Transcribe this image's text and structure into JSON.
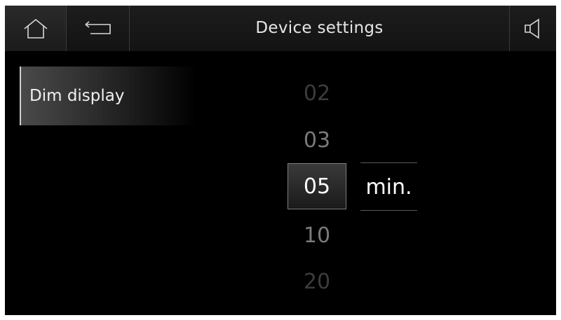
{
  "header": {
    "title": "Device settings",
    "home_icon": "home-icon",
    "back_icon": "back-arrow-icon",
    "sound_icon": "speaker-icon"
  },
  "sidebar": {
    "items": [
      {
        "label": "Dim display",
        "selected": true
      }
    ]
  },
  "picker": {
    "values": [
      "02",
      "03",
      "05",
      "10",
      "20"
    ],
    "selected": "05",
    "unit": "min."
  }
}
